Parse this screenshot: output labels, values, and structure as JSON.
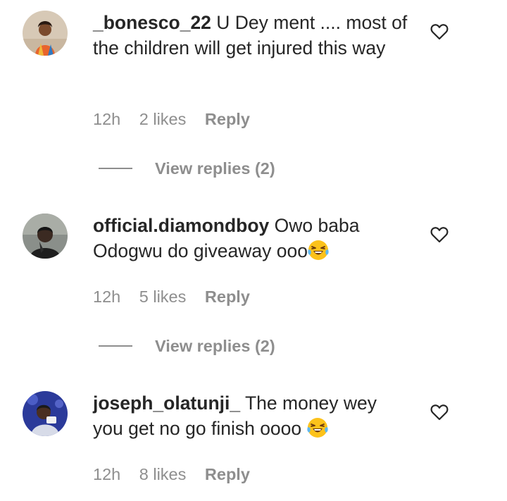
{
  "comments": [
    {
      "username": "_bonesco_22",
      "text": "U Dey ment .... most of the children will get injured this way",
      "emoji": "",
      "time": "12h",
      "likes": "2 likes",
      "reply_label": "Reply",
      "view_replies": "View replies (2)",
      "avatar_color": "#e86a3a"
    },
    {
      "username": "official.diamondboy",
      "text": "Owo baba Odogwu do giveaway ooo",
      "emoji": "😂",
      "time": "12h",
      "likes": "5 likes",
      "reply_label": "Reply",
      "view_replies": "View replies (2)",
      "avatar_color": "#5a5a5a"
    },
    {
      "username": "joseph_olatunji_",
      "text": "The money wey you get no go finish oooo",
      "emoji": "😂",
      "time": "12h",
      "likes": "8 likes",
      "reply_label": "Reply",
      "view_replies": "",
      "avatar_color": "#2f3c9e"
    }
  ],
  "icons": {
    "like": "heart-outline-icon",
    "emoji": "face-with-tears-of-joy"
  },
  "colors": {
    "text": "#262626",
    "secondary": "#8e8e8e"
  }
}
